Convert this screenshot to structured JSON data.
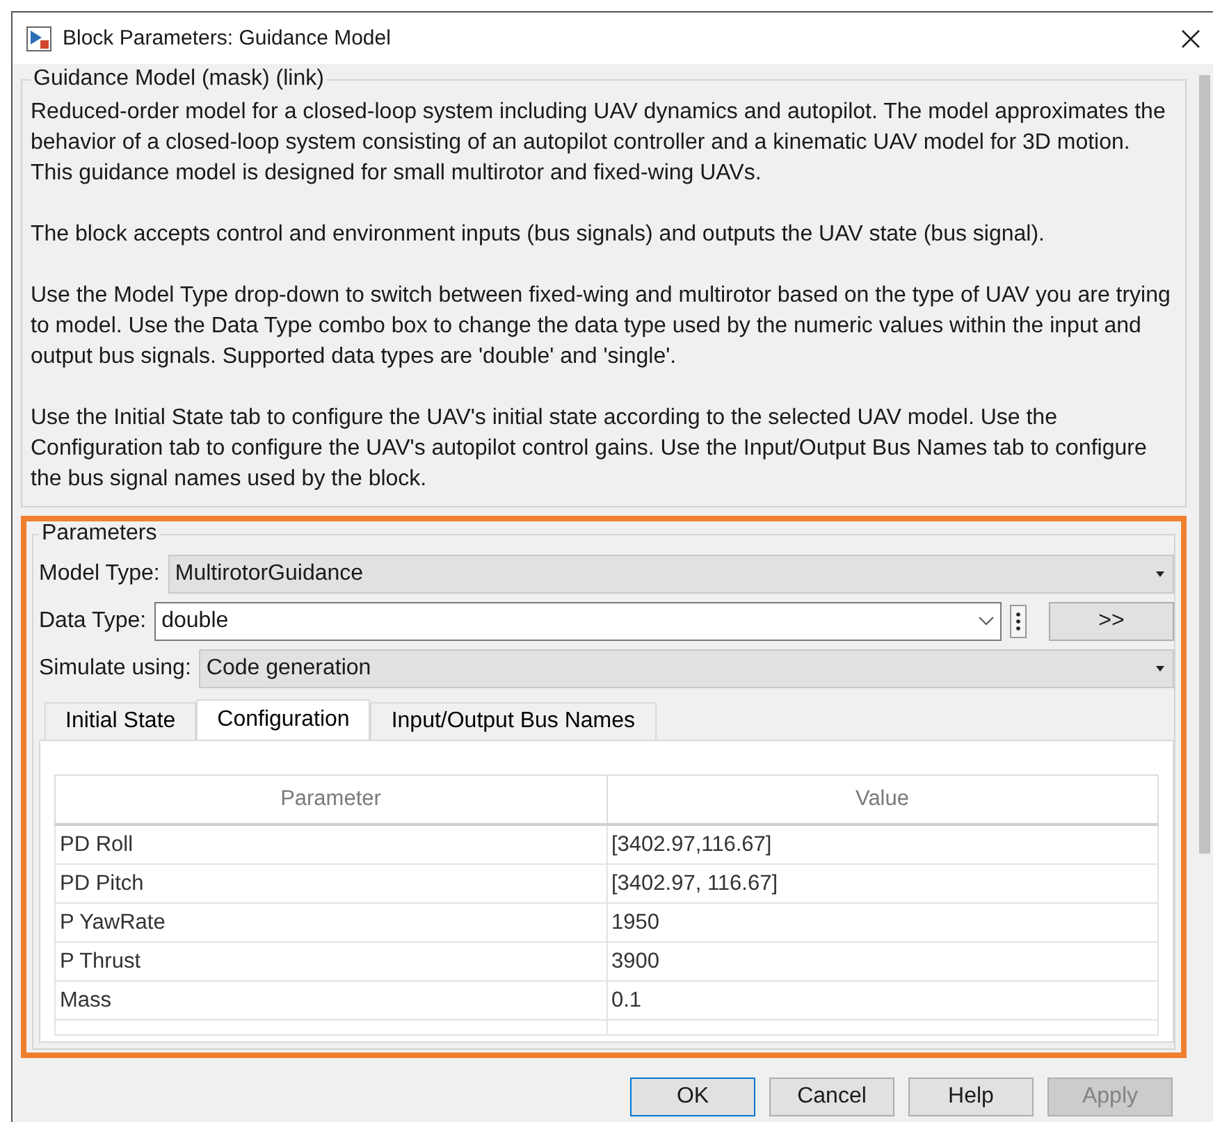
{
  "window": {
    "title": "Block Parameters: Guidance Model"
  },
  "description": {
    "title": "Guidance Model (mask) (link)",
    "paragraphs": [
      "Reduced-order model for a closed-loop system including UAV dynamics and autopilot. The model approximates the behavior of a closed-loop system consisting of an autopilot controller and a kinematic UAV model for 3D motion. This guidance model is designed for small multirotor and fixed-wing UAVs.",
      "The block accepts control and environment inputs (bus signals) and outputs the UAV state (bus signal).",
      "Use the Model Type drop-down to switch between fixed-wing and multirotor based on the type of UAV you are trying to model. Use the Data Type combo box to change the data type used by the numeric values within the input and output bus signals. Supported data types are 'double' and 'single'.",
      "Use the Initial State tab to configure the UAV's initial state according to the selected UAV model. Use the Configuration tab to configure the UAV's autopilot control gains. Use the Input/Output Bus Names tab to configure the bus signal names used by the block."
    ]
  },
  "parameters": {
    "title": "Parameters",
    "fields": [
      {
        "kind": "dropdown",
        "label": "Model Type:",
        "value": "MultirotorGuidance"
      },
      {
        "kind": "combo",
        "label": "Data Type:",
        "value": "double",
        "button": ">>"
      },
      {
        "kind": "dropdown",
        "label": "Simulate using:",
        "value": "Code generation"
      }
    ],
    "tabs": [
      {
        "label": "Initial State",
        "selected": false
      },
      {
        "label": "Configuration",
        "selected": true
      },
      {
        "label": "Input/Output Bus Names",
        "selected": false
      }
    ],
    "table": {
      "columns": [
        "Parameter",
        "Value"
      ],
      "rows": [
        [
          "PD Roll",
          "[3402.97,116.67]"
        ],
        [
          "PD Pitch",
          "[3402.97, 116.67]"
        ],
        [
          "P YawRate",
          "1950"
        ],
        [
          "P Thrust",
          "3900"
        ],
        [
          "Mass",
          "0.1"
        ]
      ]
    }
  },
  "buttons": [
    {
      "label": "OK",
      "default": true,
      "disabled": false
    },
    {
      "label": "Cancel",
      "default": false,
      "disabled": false
    },
    {
      "label": "Help",
      "default": false,
      "disabled": false
    },
    {
      "label": "Apply",
      "default": false,
      "disabled": true
    }
  ]
}
